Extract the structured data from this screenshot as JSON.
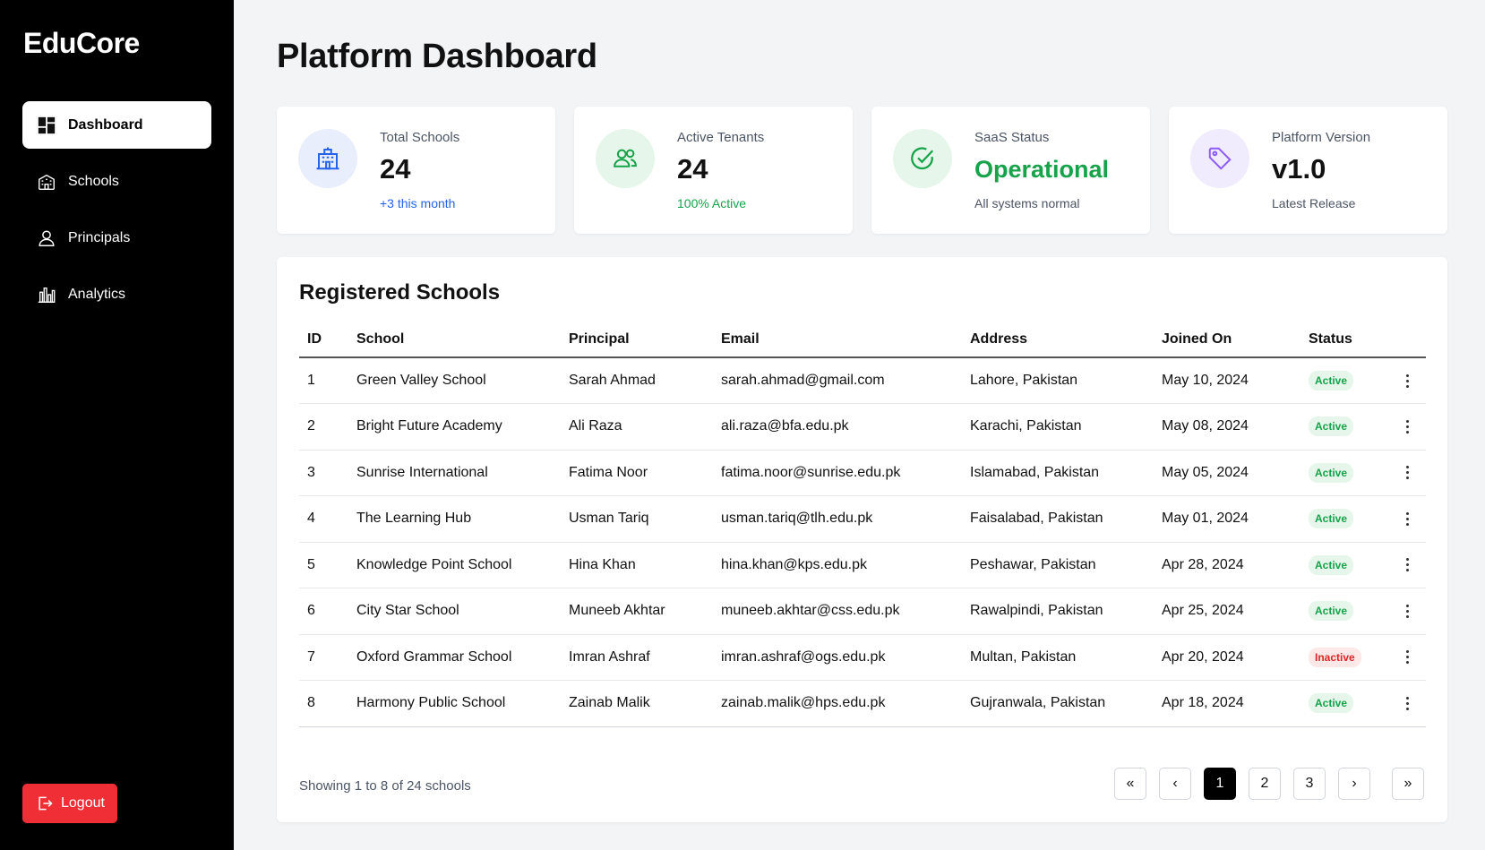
{
  "sidebar": {
    "brand": "EduCore",
    "items": [
      {
        "label": "Dashboard",
        "icon": "dashboard-grid-icon",
        "active": true
      },
      {
        "label": "Schools",
        "icon": "school-building-icon",
        "active": false
      },
      {
        "label": "Principals",
        "icon": "user-icon",
        "active": false
      },
      {
        "label": "Analytics",
        "icon": "bar-chart-icon",
        "active": false
      }
    ],
    "logout_label": "Logout"
  },
  "page_title": "Platform Dashboard",
  "stats": [
    {
      "label": "Total Schools",
      "value": "24",
      "sub": "+3 this month",
      "icon": "building-icon",
      "icon_color": "#2563eb",
      "icon_bg": "#e8eefc",
      "value_color": "#111111",
      "sub_color": "#2563eb"
    },
    {
      "label": "Active Tenants",
      "value": "24",
      "sub": "100% Active",
      "icon": "users-icon",
      "icon_color": "#16a34a",
      "icon_bg": "#e6f6ea",
      "value_color": "#111111",
      "sub_color": "#16a34a"
    },
    {
      "label": "SaaS Status",
      "value": "Operational",
      "sub": "All systems normal",
      "icon": "check-circle-icon",
      "icon_color": "#16a34a",
      "icon_bg": "#e6f6ea",
      "value_color": "#16a34a",
      "sub_color": "#4b5563"
    },
    {
      "label": "Platform Version",
      "value": "v1.0",
      "sub": "Latest Release",
      "icon": "tag-icon",
      "icon_color": "#8b5cf6",
      "icon_bg": "#f1ecfd",
      "value_color": "#111111",
      "sub_color": "#4b5563"
    }
  ],
  "schools_table": {
    "title": "Registered Schools",
    "columns": [
      "ID",
      "School",
      "Principal",
      "Email",
      "Address",
      "Joined On",
      "Status"
    ],
    "rows": [
      [
        "1",
        "Green Valley School",
        "Sarah Ahmad",
        "sarah.ahmad@gmail.com",
        "Lahore, Pakistan",
        "May 10, 2024",
        "Active"
      ],
      [
        "2",
        "Bright Future Academy",
        "Ali Raza",
        "ali.raza@bfa.edu.pk",
        "Karachi, Pakistan",
        "May 08, 2024",
        "Active"
      ],
      [
        "3",
        "Sunrise International",
        "Fatima Noor",
        "fatima.noor@sunrise.edu.pk",
        "Islamabad, Pakistan",
        "May 05, 2024",
        "Active"
      ],
      [
        "4",
        "The Learning Hub",
        "Usman Tariq",
        "usman.tariq@tlh.edu.pk",
        "Faisalabad, Pakistan",
        "May 01, 2024",
        "Active"
      ],
      [
        "5",
        "Knowledge Point School",
        "Hina Khan",
        "hina.khan@kps.edu.pk",
        "Peshawar, Pakistan",
        "Apr 28, 2024",
        "Active"
      ],
      [
        "6",
        "City Star School",
        "Muneeb Akhtar",
        "muneeb.akhtar@css.edu.pk",
        "Rawalpindi, Pakistan",
        "Apr 25, 2024",
        "Active"
      ],
      [
        "7",
        "Oxford Grammar School",
        "Imran Ashraf",
        "imran.ashraf@ogs.edu.pk",
        "Multan, Pakistan",
        "Apr 20, 2024",
        "Inactive"
      ],
      [
        "8",
        "Harmony Public School",
        "Zainab Malik",
        "zainab.malik@hps.edu.pk",
        "Gujranwala, Pakistan",
        "Apr 18, 2024",
        "Active"
      ]
    ],
    "showing_text": "Showing 1 to 8 of 24 schools",
    "pagination": {
      "first": "«",
      "prev": "‹",
      "pages": [
        "1",
        "2",
        "3"
      ],
      "current": "1",
      "next": "›",
      "last": "»"
    }
  }
}
